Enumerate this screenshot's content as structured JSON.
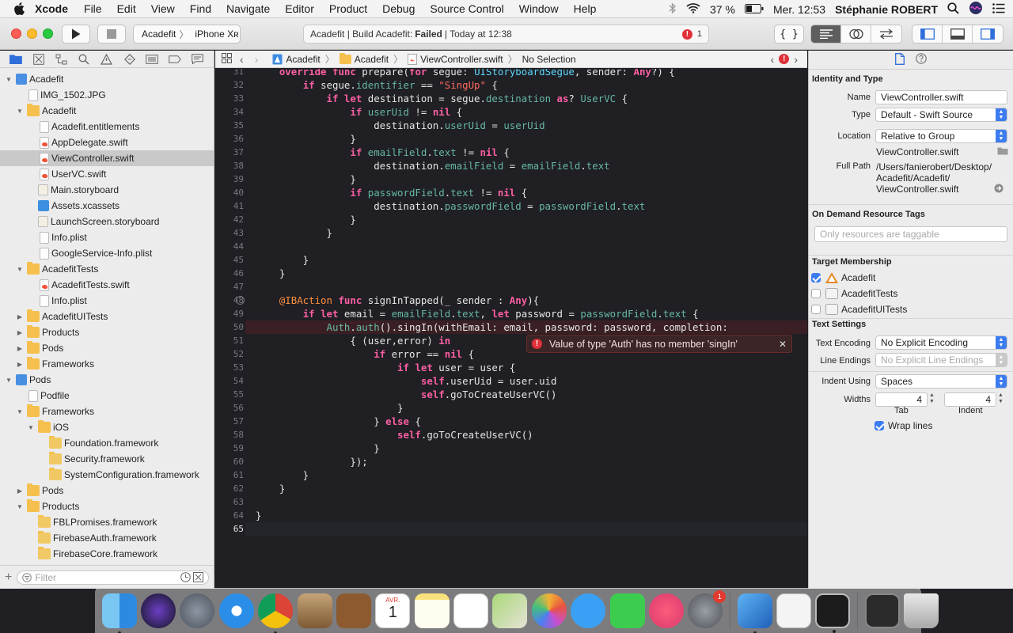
{
  "menubar": {
    "app": "Xcode",
    "items": [
      "File",
      "Edit",
      "View",
      "Find",
      "Navigate",
      "Editor",
      "Product",
      "Debug",
      "Source Control",
      "Window",
      "Help"
    ],
    "battery": "37 %",
    "clock": "Mer. 12:53",
    "user": "Stéphanie ROBERT"
  },
  "toolbar": {
    "scheme": "Acadefit",
    "device": "iPhone Xʀ",
    "activity_prefix": "Acadefit | Build Acadefit:",
    "activity_status": "Failed",
    "activity_suffix": "| Today at 12:38",
    "error_count": "1",
    "code_review_glyph": "{ }"
  },
  "navigator": {
    "filter_placeholder": "Filter",
    "items": [
      {
        "label": "Acadefit",
        "indent": 0,
        "icon": "xcodeproj-icon",
        "disclosure": "open"
      },
      {
        "label": "IMG_1502.JPG",
        "indent": 1,
        "icon": "image-file-icon",
        "disclosure": ""
      },
      {
        "label": "Acadefit",
        "indent": 1,
        "icon": "folder-icon",
        "disclosure": "open"
      },
      {
        "label": "Acadefit.entitlements",
        "indent": 2,
        "icon": "file-icon",
        "disclosure": ""
      },
      {
        "label": "AppDelegate.swift",
        "indent": 2,
        "icon": "swift-file-icon",
        "disclosure": ""
      },
      {
        "label": "ViewController.swift",
        "indent": 2,
        "icon": "swift-file-icon",
        "disclosure": "",
        "selected": true
      },
      {
        "label": "UserVC.swift",
        "indent": 2,
        "icon": "swift-file-icon",
        "disclosure": ""
      },
      {
        "label": "Main.storyboard",
        "indent": 2,
        "icon": "storyboard-icon",
        "disclosure": ""
      },
      {
        "label": "Assets.xcassets",
        "indent": 2,
        "icon": "assets-icon",
        "disclosure": ""
      },
      {
        "label": "LaunchScreen.storyboard",
        "indent": 2,
        "icon": "storyboard-icon",
        "disclosure": ""
      },
      {
        "label": "Info.plist",
        "indent": 2,
        "icon": "plist-icon",
        "disclosure": ""
      },
      {
        "label": "GoogleService-Info.plist",
        "indent": 2,
        "icon": "plist-icon",
        "disclosure": ""
      },
      {
        "label": "AcadefitTests",
        "indent": 1,
        "icon": "folder-icon",
        "disclosure": "open"
      },
      {
        "label": "AcadefitTests.swift",
        "indent": 2,
        "icon": "swift-file-icon",
        "disclosure": ""
      },
      {
        "label": "Info.plist",
        "indent": 2,
        "icon": "plist-icon",
        "disclosure": ""
      },
      {
        "label": "AcadefitUITests",
        "indent": 1,
        "icon": "folder-icon",
        "disclosure": "closed"
      },
      {
        "label": "Products",
        "indent": 1,
        "icon": "folder-icon",
        "disclosure": "closed"
      },
      {
        "label": "Pods",
        "indent": 1,
        "icon": "folder-icon",
        "disclosure": "closed"
      },
      {
        "label": "Frameworks",
        "indent": 1,
        "icon": "folder-icon",
        "disclosure": "closed"
      },
      {
        "label": "Pods",
        "indent": 0,
        "icon": "xcodeproj-icon",
        "disclosure": "open"
      },
      {
        "label": "Podfile",
        "indent": 1,
        "icon": "ruby-file-icon",
        "disclosure": ""
      },
      {
        "label": "Frameworks",
        "indent": 1,
        "icon": "folder-icon",
        "disclosure": "open"
      },
      {
        "label": "iOS",
        "indent": 2,
        "icon": "folder-icon",
        "disclosure": "open"
      },
      {
        "label": "Foundation.framework",
        "indent": 3,
        "icon": "framework-icon",
        "disclosure": ""
      },
      {
        "label": "Security.framework",
        "indent": 3,
        "icon": "framework-icon",
        "disclosure": ""
      },
      {
        "label": "SystemConfiguration.framework",
        "indent": 3,
        "icon": "framework-icon",
        "disclosure": ""
      },
      {
        "label": "Pods",
        "indent": 1,
        "icon": "folder-icon",
        "disclosure": "closed"
      },
      {
        "label": "Products",
        "indent": 1,
        "icon": "folder-icon",
        "disclosure": "open"
      },
      {
        "label": "FBLPromises.framework",
        "indent": 2,
        "icon": "framework-icon",
        "disclosure": ""
      },
      {
        "label": "FirebaseAuth.framework",
        "indent": 2,
        "icon": "framework-icon",
        "disclosure": ""
      },
      {
        "label": "FirebaseCore.framework",
        "indent": 2,
        "icon": "framework-icon",
        "disclosure": ""
      }
    ]
  },
  "jumpbar": {
    "crumbs": [
      "Acadefit",
      "Acadefit",
      "ViewController.swift",
      "No Selection"
    ]
  },
  "editor": {
    "current_line": 65,
    "error_line": 50,
    "error_message": "Value of type 'Auth' has no member 'singIn'",
    "lines": [
      {
        "n": 31,
        "html": "    <span class='kw'>override</span> <span class='kw'>func</span> prepare(<span class='kw'>for</span> segue: <span class='ty'>UIStoryboardSegue</span>, sender: <span class='kw'>Any</span>?) {"
      },
      {
        "n": 32,
        "html": "        <span class='kw'>if</span> segue.<span class='pr'>identifier</span> == <span class='st'>\"SingUp\"</span> {"
      },
      {
        "n": 33,
        "html": "            <span class='kw'>if</span> <span class='kw'>let</span> destination = segue.<span class='pr'>destination</span> <span class='kw'>as</span>? <span class='pr'>UserVC</span> {"
      },
      {
        "n": 34,
        "html": "                <span class='kw'>if</span> <span class='pr'>userUid</span> != <span class='kw'>nil</span> {"
      },
      {
        "n": 35,
        "html": "                    destination.<span class='pr'>userUid</span> = <span class='pr'>userUid</span>"
      },
      {
        "n": 36,
        "html": "                }"
      },
      {
        "n": 37,
        "html": "                <span class='kw'>if</span> <span class='pr'>emailField</span>.<span class='pr'>text</span> != <span class='kw'>nil</span> {"
      },
      {
        "n": 38,
        "html": "                    destination.<span class='pr'>emailField</span> = <span class='pr'>emailField</span>.<span class='pr'>text</span>"
      },
      {
        "n": 39,
        "html": "                }"
      },
      {
        "n": 40,
        "html": "                <span class='kw'>if</span> <span class='pr'>passwordField</span>.<span class='pr'>text</span> != <span class='kw'>nil</span> {"
      },
      {
        "n": 41,
        "html": "                    destination.<span class='pr'>passwordField</span> = <span class='pr'>passwordField</span>.<span class='pr'>text</span>"
      },
      {
        "n": 42,
        "html": "                }"
      },
      {
        "n": 43,
        "html": "            }"
      },
      {
        "n": 44,
        "html": ""
      },
      {
        "n": 45,
        "html": "        }"
      },
      {
        "n": 46,
        "html": "    }"
      },
      {
        "n": 47,
        "html": ""
      },
      {
        "n": 48,
        "html": "    <span class='at'>@IBAction</span> <span class='kw'>func</span> signInTapped(_ sender : <span class='kw'>Any</span>){",
        "bp": true
      },
      {
        "n": 49,
        "html": "        <span class='kw'>if</span> <span class='kw'>let</span> email = <span class='pr'>emailField</span>.<span class='pr'>text</span>, <span class='kw'>let</span> password = <span class='pr'>passwordField</span>.<span class='pr'>text</span> {"
      },
      {
        "n": 50,
        "html": "            <span class='pr'>Auth</span>.<span class='pr'>auth</span>().singIn(withEmail: email, password: password, completion:",
        "err": true
      },
      {
        "n": 51,
        "html": "                { (user,error) <span class='kw'>in</span>"
      },
      {
        "n": 52,
        "html": "                    <span class='kw'>if</span> error == <span class='kw'>nil</span> {"
      },
      {
        "n": 53,
        "html": "                        <span class='kw'>if</span> <span class='kw'>let</span> user = user {"
      },
      {
        "n": 54,
        "html": "                            <span class='kw'>self</span>.userUid = user.uid"
      },
      {
        "n": 55,
        "html": "                            <span class='kw'>self</span>.goToCreateUserVC()"
      },
      {
        "n": 56,
        "html": "                        }"
      },
      {
        "n": 57,
        "html": "                    } <span class='kw'>else</span> {"
      },
      {
        "n": 58,
        "html": "                        <span class='kw'>self</span>.goToCreateUserVC()"
      },
      {
        "n": 59,
        "html": "                    }"
      },
      {
        "n": 60,
        "html": "                });"
      },
      {
        "n": 61,
        "html": "        }"
      },
      {
        "n": 62,
        "html": "    }"
      },
      {
        "n": 63,
        "html": ""
      },
      {
        "n": 64,
        "html": "}"
      },
      {
        "n": 65,
        "html": "",
        "cur": true
      }
    ]
  },
  "inspector": {
    "identity_title": "Identity and Type",
    "name_label": "Name",
    "name_value": "ViewController.swift",
    "type_label": "Type",
    "type_value": "Default - Swift Source",
    "location_label": "Location",
    "location_value": "Relative to Group",
    "location_file": "ViewController.swift",
    "fullpath_label": "Full Path",
    "fullpath_1": "/Users/fanierobert/Desktop/",
    "fullpath_2": "Acadefit/Acadefit/",
    "fullpath_3": "ViewController.swift",
    "ondemand_title": "On Demand Resource Tags",
    "tags_placeholder": "Only resources are taggable",
    "target_title": "Target Membership",
    "targets": [
      {
        "label": "Acadefit",
        "checked": true
      },
      {
        "label": "AcadefitTests",
        "checked": false
      },
      {
        "label": "AcadefitUITests",
        "checked": false
      }
    ],
    "text_settings_title": "Text Settings",
    "encoding_label": "Text Encoding",
    "encoding_value": "No Explicit Encoding",
    "line_endings_label": "Line Endings",
    "line_endings_value": "No Explicit Line Endings",
    "indent_label": "Indent Using",
    "indent_value": "Spaces",
    "widths_label": "Widths",
    "tab_value": "4",
    "indent_width_value": "4",
    "tab_caption": "Tab",
    "indent_caption": "Indent",
    "wrap_label": "Wrap lines",
    "wrap_checked": true
  },
  "dock": {
    "calendar_month": "AVR.",
    "calendar_day": "1",
    "prefs_badge": "1"
  },
  "colors": {
    "editor_bg": "#1f1f24",
    "keyword": "#fc5fa3",
    "string": "#fc6a5d",
    "type": "#5dd8ff",
    "property": "#67b7a4",
    "error": "#e0303a",
    "accent": "#3d7cf0"
  }
}
